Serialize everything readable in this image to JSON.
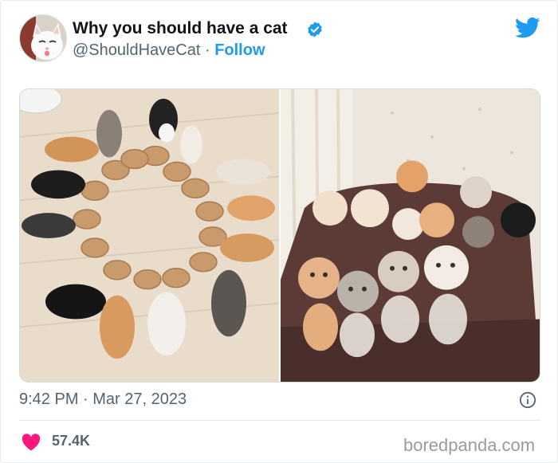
{
  "tweet": {
    "display_name": "Why you should have a cat",
    "handle": "@ShouldHaveCat",
    "separator": "·",
    "follow_label": "Follow",
    "verified": true,
    "timestamp": "9:42 PM · Mar 27, 2023",
    "likes": "57.4K"
  },
  "media": {
    "images": [
      {
        "name": "kittens-eating-circle-photo"
      },
      {
        "name": "kittens-group-on-cat-bed-photo"
      }
    ]
  },
  "icons": {
    "brand": "twitter-bird-icon",
    "verified": "verified-badge-icon",
    "info": "info-icon",
    "like": "heart-icon"
  },
  "colors": {
    "accent": "#1d9bf0",
    "heart": "#f91880",
    "text_secondary": "#536471"
  },
  "watermark": "boredpanda.com"
}
